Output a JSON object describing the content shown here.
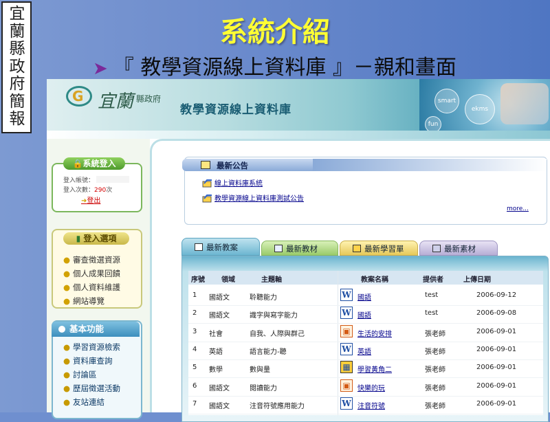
{
  "slide": {
    "side_label": "宜蘭縣政府簡報",
    "title": "系統介紹",
    "subtitle": "『 教學資源線上資料庫 』－親和畫面"
  },
  "banner": {
    "logo_text": "宜蘭",
    "logo_gov": "縣政府",
    "site_title": "教學資源線上資料庫",
    "bubble1": "smart",
    "bubble2": "ekms",
    "bubble3": "fun"
  },
  "login": {
    "header": "系統登入",
    "account_label": "登入帳號：",
    "count_label": "登入次數：",
    "count_value": "290",
    "count_unit": "次",
    "logout": "登出"
  },
  "options": {
    "header": "登入選項",
    "items": [
      "審查徵選資源",
      "個人成果回饋",
      "個人資料維護",
      "網站導覽"
    ]
  },
  "basic": {
    "header": "基本功能",
    "items": [
      "學習資源檢索",
      "資料庫查詢",
      "討論區",
      "歷屆徵選活動",
      "友站連結"
    ]
  },
  "news": {
    "header": "最新公告",
    "items": [
      "線上資料庫系統",
      "教學資源線上資料庫測試公告"
    ],
    "more": "more..."
  },
  "tabs": [
    "最新教案",
    "最新教材",
    "最新學習單",
    "最新素材"
  ],
  "table": {
    "headers": [
      "序號",
      "領域",
      "主題軸",
      "教案名稱",
      "提供者",
      "上傳日期"
    ],
    "rows": [
      {
        "no": "1",
        "domain": "國語文",
        "topic": "聆聽能力",
        "name": "國語",
        "icon": "word-icon",
        "provider": "test",
        "date": "2006-09-12"
      },
      {
        "no": "2",
        "domain": "國語文",
        "topic": "識字與寫字能力",
        "name": "國語",
        "icon": "word-icon",
        "provider": "test",
        "date": "2006-09-08"
      },
      {
        "no": "3",
        "domain": "社會",
        "topic": "自我、人際與群己",
        "name": "生活的安排",
        "icon": "ppt-icon",
        "provider": "張老師",
        "date": "2006-09-01"
      },
      {
        "no": "4",
        "domain": "英語",
        "topic": "語言能力-聽",
        "name": "英語",
        "icon": "word-icon",
        "provider": "張老師",
        "date": "2006-09-01"
      },
      {
        "no": "5",
        "domain": "數學",
        "topic": "數與量",
        "name": "學習黃角二",
        "icon": "multimedia-icon",
        "provider": "張老師",
        "date": "2006-09-01"
      },
      {
        "no": "6",
        "domain": "國語文",
        "topic": "閱讀能力",
        "name": "快樂的玩",
        "icon": "ppt-icon",
        "provider": "張老師",
        "date": "2006-09-01"
      },
      {
        "no": "7",
        "domain": "國語文",
        "topic": "注音符號應用能力",
        "name": "注音符號",
        "icon": "word-icon",
        "provider": "張老師",
        "date": "2006-09-01"
      }
    ]
  }
}
